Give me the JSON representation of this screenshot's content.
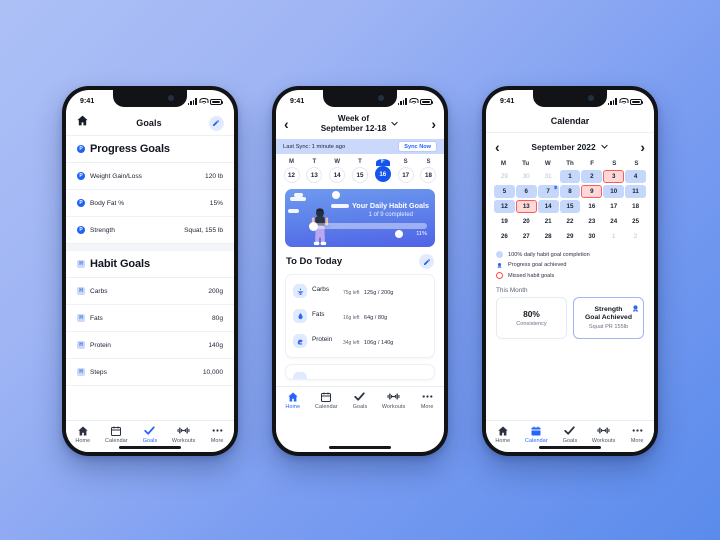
{
  "theme": {
    "accent": "#2563ff",
    "accent_dark": "#1455ee",
    "bg_top": "#adc0f6",
    "bg_bottom": "#5a8bec",
    "miss_red": "#ff4d4d",
    "highlight_blue": "#c5d8fb"
  },
  "status_bar": {
    "time": "9:41"
  },
  "phone1": {
    "appbar": {
      "title": "Goals",
      "home_icon": "home-icon",
      "edit_icon": "pencil-icon"
    },
    "sections": [
      {
        "badge": "P",
        "title": "Progress Goals",
        "rows": [
          {
            "badge": "P",
            "name": "Weight Gain/Loss",
            "value": "120 lb"
          },
          {
            "badge": "P",
            "name": "Body Fat %",
            "value": "15%"
          },
          {
            "badge": "P",
            "name": "Strength",
            "value": "Squat, 155 lb"
          }
        ]
      },
      {
        "badge": "H",
        "title": "Habit Goals",
        "rows": [
          {
            "badge": "H",
            "name": "Carbs",
            "value": "200g"
          },
          {
            "badge": "H",
            "name": "Fats",
            "value": "80g"
          },
          {
            "badge": "H",
            "name": "Protein",
            "value": "140g"
          },
          {
            "badge": "H",
            "name": "Steps",
            "value": "10,000"
          }
        ]
      }
    ],
    "tabs": [
      {
        "label": "Home",
        "icon": "home-icon",
        "active": false
      },
      {
        "label": "Calendar",
        "icon": "calendar-icon",
        "active": false
      },
      {
        "label": "Goals",
        "icon": "check-icon",
        "active": true
      },
      {
        "label": "Workouts",
        "icon": "dumbbell-icon",
        "active": false
      },
      {
        "label": "More",
        "icon": "ellipsis-icon",
        "active": false
      }
    ]
  },
  "phone2": {
    "header": {
      "line1": "Week of",
      "line2": "September 12-18",
      "prev_icon": "chevron-left-icon",
      "next_icon": "chevron-right-icon",
      "dropdown_icon": "chevron-down-icon"
    },
    "sync": {
      "text": "Last Sync: 1 minute ago",
      "button": "Sync Now"
    },
    "week": [
      {
        "letter": "M",
        "num": "12",
        "selected": false
      },
      {
        "letter": "T",
        "num": "13",
        "selected": false
      },
      {
        "letter": "W",
        "num": "14",
        "selected": false
      },
      {
        "letter": "T",
        "num": "15",
        "selected": false
      },
      {
        "letter": "F",
        "num": "16",
        "selected": true
      },
      {
        "letter": "S",
        "num": "17",
        "selected": false
      },
      {
        "letter": "S",
        "num": "18",
        "selected": false
      }
    ],
    "banner": {
      "title": "Your Daily Habit Goals",
      "subtitle": "1 of 9 completed",
      "percent_label": "11%",
      "percent_value": 11
    },
    "todo": {
      "title": "To Do Today",
      "edit_icon": "pencil-icon"
    },
    "macros": [
      {
        "icon": "carbs-icon",
        "name": "Carbs",
        "left": "75g left",
        "value": "125g / 200g",
        "percent": 62
      },
      {
        "icon": "fats-icon",
        "name": "Fats",
        "left": "16g left",
        "value": "64g / 80g",
        "percent": 80
      },
      {
        "icon": "protein-icon",
        "name": "Protein",
        "left": "34g left",
        "value": "106g / 140g",
        "percent": 76
      }
    ],
    "tabs": [
      {
        "label": "Home",
        "icon": "home-icon",
        "active": true
      },
      {
        "label": "Calendar",
        "icon": "calendar-icon",
        "active": false
      },
      {
        "label": "Goals",
        "icon": "check-icon",
        "active": false
      },
      {
        "label": "Workouts",
        "icon": "dumbbell-icon",
        "active": false
      },
      {
        "label": "More",
        "icon": "ellipsis-icon",
        "active": false
      }
    ]
  },
  "phone3": {
    "appbar": {
      "title": "Calendar"
    },
    "monthnav": {
      "month": "September 2022",
      "prev_icon": "chevron-left-icon",
      "next_icon": "chevron-right-icon",
      "dropdown_icon": "chevron-down-icon"
    },
    "dow": [
      "M",
      "Tu",
      "W",
      "Th",
      "F",
      "S",
      "S"
    ],
    "days": [
      {
        "n": "29",
        "state": "mute"
      },
      {
        "n": "30",
        "state": "mute"
      },
      {
        "n": "31",
        "state": "mute"
      },
      {
        "n": "1",
        "state": "hl"
      },
      {
        "n": "2",
        "state": "hl"
      },
      {
        "n": "3",
        "state": "miss"
      },
      {
        "n": "4",
        "state": "hl"
      },
      {
        "n": "5",
        "state": "hl"
      },
      {
        "n": "6",
        "state": "hl"
      },
      {
        "n": "7",
        "state": "hl",
        "pr": true
      },
      {
        "n": "8",
        "state": "hl"
      },
      {
        "n": "9",
        "state": "miss"
      },
      {
        "n": "10",
        "state": "hl"
      },
      {
        "n": "11",
        "state": "hl"
      },
      {
        "n": "12",
        "state": "hl"
      },
      {
        "n": "13",
        "state": "miss"
      },
      {
        "n": "14",
        "state": "hl"
      },
      {
        "n": "15",
        "state": "hl"
      },
      {
        "n": "16",
        "state": "plain"
      },
      {
        "n": "17",
        "state": "plain"
      },
      {
        "n": "18",
        "state": "plain"
      },
      {
        "n": "19",
        "state": "plain"
      },
      {
        "n": "20",
        "state": "plain"
      },
      {
        "n": "21",
        "state": "plain"
      },
      {
        "n": "22",
        "state": "plain"
      },
      {
        "n": "23",
        "state": "plain"
      },
      {
        "n": "24",
        "state": "plain"
      },
      {
        "n": "25",
        "state": "plain"
      },
      {
        "n": "26",
        "state": "plain"
      },
      {
        "n": "27",
        "state": "plain"
      },
      {
        "n": "28",
        "state": "plain"
      },
      {
        "n": "29",
        "state": "plain"
      },
      {
        "n": "30",
        "state": "plain"
      },
      {
        "n": "1",
        "state": "mute"
      },
      {
        "n": "2",
        "state": "mute"
      }
    ],
    "legend": [
      {
        "marker": "dot",
        "text": "100% daily habit goal completion"
      },
      {
        "marker": "medal",
        "text": "Progress goal achieved"
      },
      {
        "marker": "ring",
        "text": "Missed habit goals"
      }
    ],
    "this_month_label": "This Month",
    "stats": [
      {
        "type": "percent",
        "big": "80%",
        "sub": "Consistency"
      },
      {
        "type": "achievement",
        "line1": "Strength",
        "line2": "Goal Achieved",
        "sub": "Squat PR 155lb",
        "icon": "medal-icon"
      }
    ],
    "tabs": [
      {
        "label": "Home",
        "icon": "home-icon",
        "active": false
      },
      {
        "label": "Calendar",
        "icon": "calendar-icon",
        "active": true
      },
      {
        "label": "Goals",
        "icon": "check-icon",
        "active": false
      },
      {
        "label": "Workouts",
        "icon": "dumbbell-icon",
        "active": false
      },
      {
        "label": "More",
        "icon": "ellipsis-icon",
        "active": false
      }
    ]
  }
}
